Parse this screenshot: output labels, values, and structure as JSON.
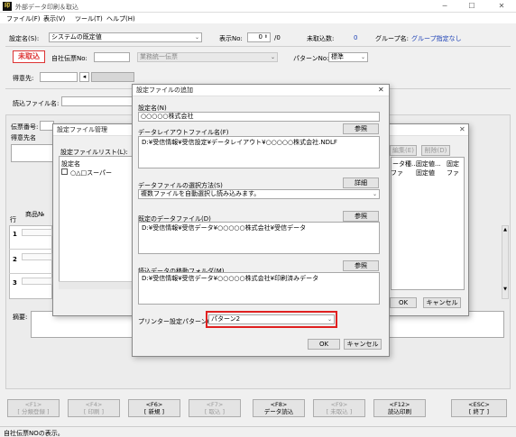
{
  "window": {
    "app_icon": "印",
    "title": "外部データ印刷＆取込"
  },
  "menu": [
    "ファイル(F)",
    "表示(V)",
    "ツール(T)",
    "ヘルプ(H)"
  ],
  "top": {
    "setting_label": "設定名(S):",
    "setting_value": "システムの既定値",
    "display_no_label": "表示No:",
    "display_no_value": "0",
    "display_no_total": "/0",
    "unimported_label": "未取込数:",
    "unimported_value": "0",
    "group_label": "グループ名:",
    "group_value": "グループ指定なし"
  },
  "row2": {
    "status_badge": "未取込",
    "slip_no_label": "自社伝票No:",
    "business_combo": "業務統一伝票",
    "pattern_label": "パターンNo:",
    "pattern_value": "標準"
  },
  "row3": {
    "customer_label": "得意先:"
  },
  "file_row": {
    "label": "読込ファイル名:"
  },
  "bg_form": {
    "slip_no_label": "伝票番号:",
    "customer_name_label": "得意先名",
    "product_label": "商品№",
    "row_label": "行",
    "rows": [
      "1",
      "2",
      "3"
    ],
    "remarks_label": "摘要:"
  },
  "mgmt_dialog": {
    "title": "設定ファイル管理",
    "list_label": "設定ファイルリスト(L):",
    "col_name": "設定名",
    "item": "○△□スーパー",
    "edit_button": "編集(E)",
    "delete_button": "削除(D)",
    "col_data": "ータ種...",
    "col_fixed1": "固定値...",
    "col_fixed2": "固定",
    "col_fixed_value": "固定値",
    "col_ff": "ファ",
    "ok_button": "OK",
    "cancel_button": "キャンセル"
  },
  "add_dialog": {
    "title": "設定ファイルの追加",
    "close_glyph": "✕",
    "name_label": "設定名(N)",
    "name_value": "○○○○○株式会社",
    "layout_label": "データレイアウトファイル名(F)",
    "browse": "参照",
    "layout_value": "D:¥受信情報¥受信設定¥データレイアウト¥○○○○○株式会社.NDLF",
    "select_method_label": "データファイルの選択方法(S)",
    "detail_button": "詳細",
    "select_method_value": "複数ファイルを自動選択し読み込みます。",
    "datafile_label": "既定のデータファイル(D)",
    "datafile_value": "D:¥受信情報¥受信データ¥○○○○○株式会社¥受信データ",
    "move_folder_label": "読込データの移動フォルダ(M)",
    "move_folder_value": "D:¥受信情報¥受信データ¥○○○○○株式会社¥印刷済みデータ",
    "printer_label": "プリンター設定パターン(P):",
    "printer_value": "パターン2",
    "ok_button": "OK",
    "cancel_button": "キャンセル"
  },
  "fkeys": [
    {
      "key": "<F1>",
      "label": "[ 分類登録 ]",
      "enabled": false
    },
    {
      "key": "<F4>",
      "label": "[ 印刷 ]",
      "enabled": false
    },
    {
      "key": "<F6>",
      "label": "[ 新規 ]",
      "enabled": true
    },
    {
      "key": "<F7>",
      "label": "[ 取込 ]",
      "enabled": false
    },
    {
      "key": "<F8>",
      "label": "データ読込",
      "enabled": true
    },
    {
      "key": "<F9>",
      "label": "[ 未取込 ]",
      "enabled": false
    },
    {
      "key": "<F12>",
      "label": "読込印刷",
      "enabled": true
    },
    {
      "key": "<ESC>",
      "label": "[ 終了 ]",
      "enabled": true
    }
  ],
  "status_text": "自社伝票NOの表示。",
  "colors": {
    "accent_blue": "#1a3fb5",
    "unimported_red": "#d33333",
    "highlight_red": "#e02020"
  }
}
